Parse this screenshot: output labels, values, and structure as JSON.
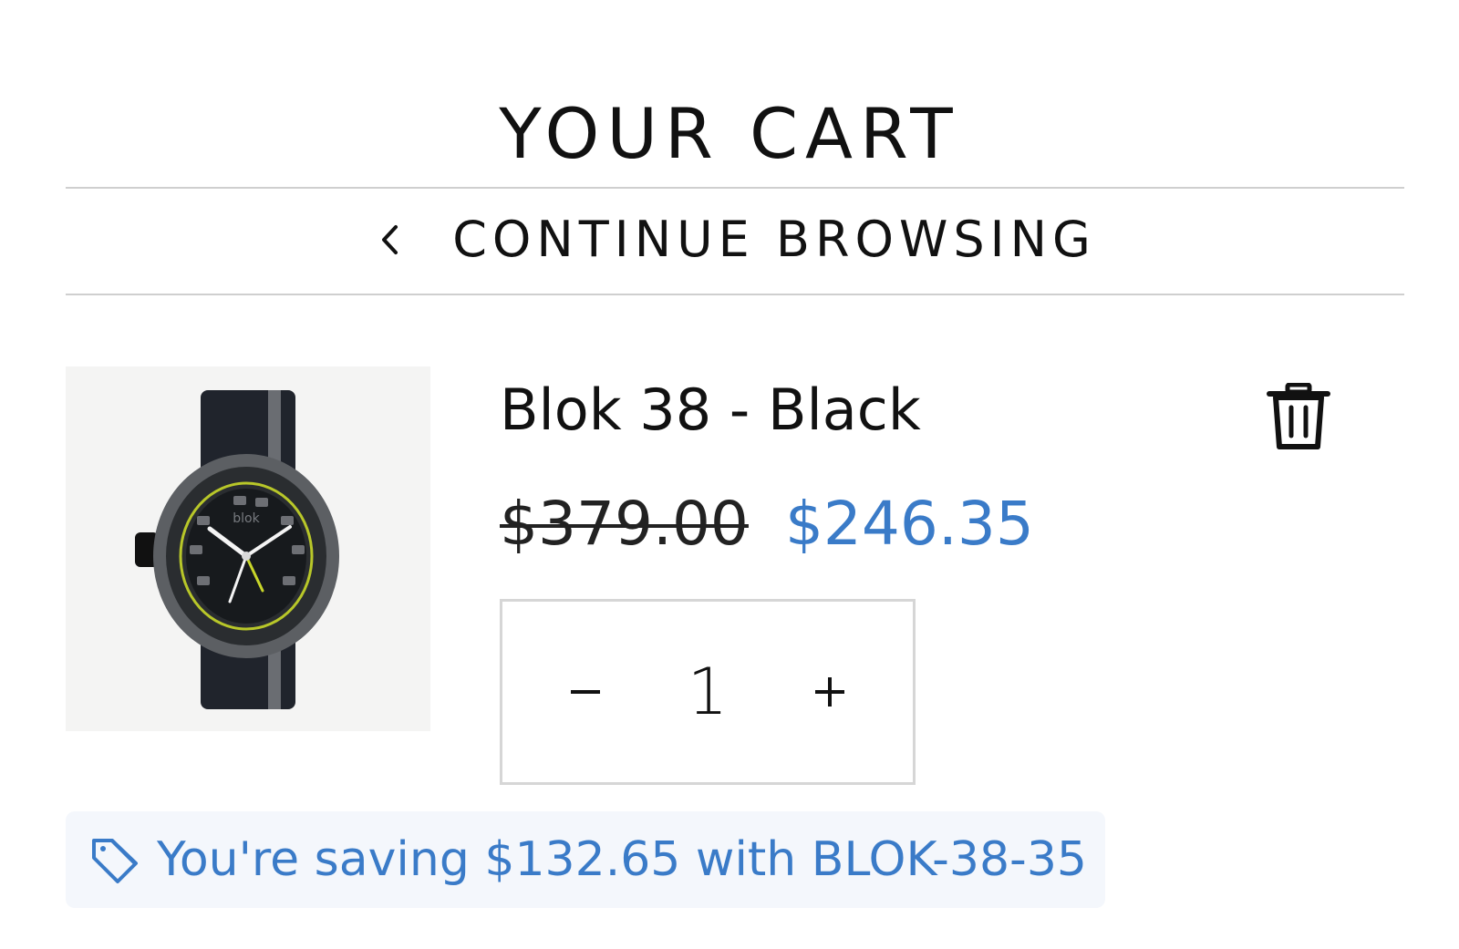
{
  "header": {
    "title": "YOUR CART"
  },
  "navigation": {
    "continue_label": "CONTINUE BROWSING",
    "icon": "chevron-left-icon"
  },
  "cart_item": {
    "name": "Blok 38 - Black",
    "original_price": "$379.00",
    "sale_price": "$246.35",
    "quantity": "1",
    "decrement_label": "-",
    "increment_label": "+",
    "image_logo_text": "blok",
    "remove_icon": "trash-icon"
  },
  "savings": {
    "message": "You're saving $132.65 with BLOK-38-35",
    "icon": "tag-icon"
  },
  "colors": {
    "accent": "#3a7bc8",
    "text": "#111111",
    "divider": "#cfcfcf",
    "savings_background": "#f4f7fc"
  }
}
